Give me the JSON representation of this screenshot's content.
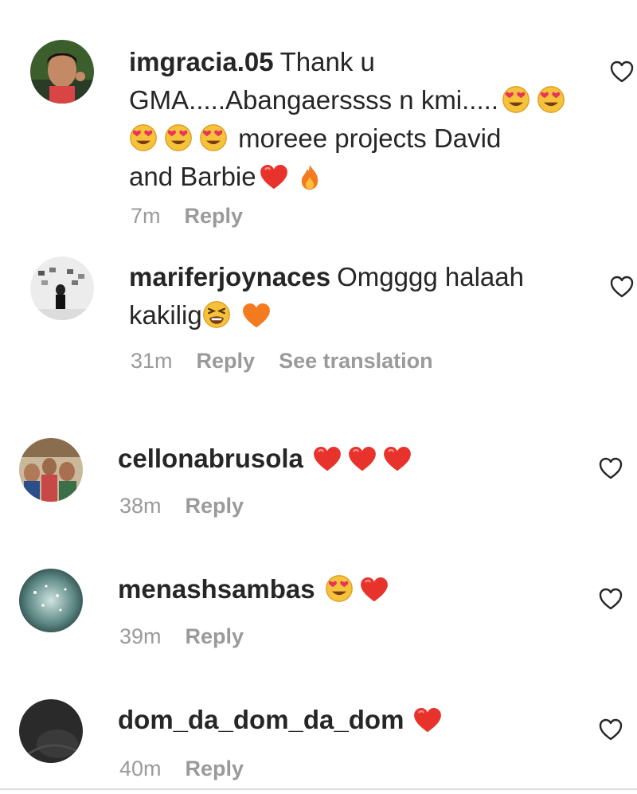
{
  "comments": [
    {
      "username": "imgracia.05",
      "text_lines": [
        "Thank u",
        "GMA.....Abangaerssss n kmi.....",
        "moreee projects David",
        "and Barbie"
      ],
      "time": "7m",
      "reply": "Reply"
    },
    {
      "username": "mariferjoynaces",
      "text_lines": [
        "Omgggg halaah",
        "kakilig"
      ],
      "time": "31m",
      "reply": "Reply",
      "translate": "See translation"
    },
    {
      "username": "cellonabrusola",
      "time": "38m",
      "reply": "Reply"
    },
    {
      "username": "menashsambas",
      "time": "39m",
      "reply": "Reply"
    },
    {
      "username": "dom_da_dom_da_dom",
      "time": "40m",
      "reply": "Reply"
    }
  ],
  "icons": {
    "heart_emoji": "red-heart-emoji",
    "heart_eyes": "smiling-face-with-heart-eyes-emoji",
    "fire": "fire-emoji",
    "orange_heart": "orange-heart-emoji",
    "squint_face": "tired-face-emoji",
    "like": "heart-outline-icon"
  },
  "colors": {
    "text": "#262626",
    "meta": "#9a9a9a",
    "heart_red": "#e8332d",
    "orange": "#f47a20"
  }
}
